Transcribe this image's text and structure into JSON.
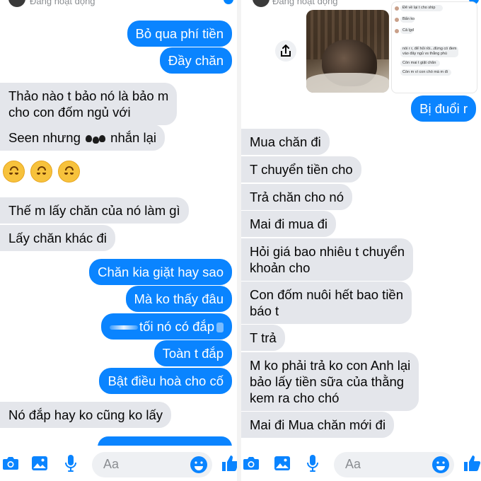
{
  "left": {
    "status": "Đang hoạt động",
    "messages": [
      {
        "text": "Bỏ qua phí tiền",
        "dir": "out"
      },
      {
        "text": "Đầy chăn",
        "dir": "out"
      },
      {
        "line1": "Thảo nào t bảo nó là bảo m",
        "line2": "cho con đốm ngủ với",
        "dir": "in"
      },
      {
        "pre": "Seen nhưng",
        "post": "nhắn lại",
        "dir": "in"
      },
      {
        "text": "Thế m lấy chăn của nó làm gì",
        "dir": "in"
      },
      {
        "text": "Lấy chăn khác đi",
        "dir": "in"
      },
      {
        "text": "Chăn kia giặt hay sao",
        "dir": "out"
      },
      {
        "text": "Mà ko thấy đâu",
        "dir": "out"
      },
      {
        "text": "tối nó có đắp",
        "dir": "out"
      },
      {
        "text": "Toàn t đắp",
        "dir": "out"
      },
      {
        "text": "Bật điều hoà cho cố",
        "dir": "out"
      },
      {
        "text": "Nó đắp hay ko cũng ko lấy",
        "dir": "in"
      }
    ],
    "emoji": "upside-down-face-emoji",
    "composer": {
      "placeholder": "Aa"
    }
  },
  "right": {
    "status": "Đang hoạt động",
    "shared_screenshot": {
      "lines": [
        "Đê về lại t cho ship",
        "Bẩn ko",
        "Cả lgđ",
        "nói r r, để hỏi rồi...đừng có đem",
        "vào đây ngủ vs thằng phú",
        "Còn mai t giặt chăn",
        "Còn m vì con chó mà m đi"
      ]
    },
    "messages": [
      {
        "text": "Bị đuổi r",
        "dir": "out"
      },
      {
        "text": "Mua chăn đi",
        "dir": "in"
      },
      {
        "text": "T chuyển tiền cho",
        "dir": "in"
      },
      {
        "text": "Trả chăn cho nó",
        "dir": "in"
      },
      {
        "text": "Mai đi mua đi",
        "dir": "in"
      },
      {
        "line1": "Hỏi giá bao nhiêu t chuyển",
        "line2": "khoản cho",
        "dir": "in"
      },
      {
        "line1": "Con đốm nuôi hết bao tiền",
        "line2": "báo t",
        "dir": "in"
      },
      {
        "text": "T trả",
        "dir": "in"
      },
      {
        "line1": "M ko phải trả ko con Anh lại",
        "line2": "bảo lấy tiền sữa của thằng",
        "line3": "kem ra cho chó",
        "dir": "in"
      },
      {
        "text": "Mai đi Mua chăn mới đi",
        "dir": "in"
      }
    ],
    "composer": {
      "placeholder": "Aa"
    }
  },
  "colors": {
    "accent": "#0a84ff",
    "incoming_bubble": "#e4e6eb",
    "text": "#050505"
  }
}
